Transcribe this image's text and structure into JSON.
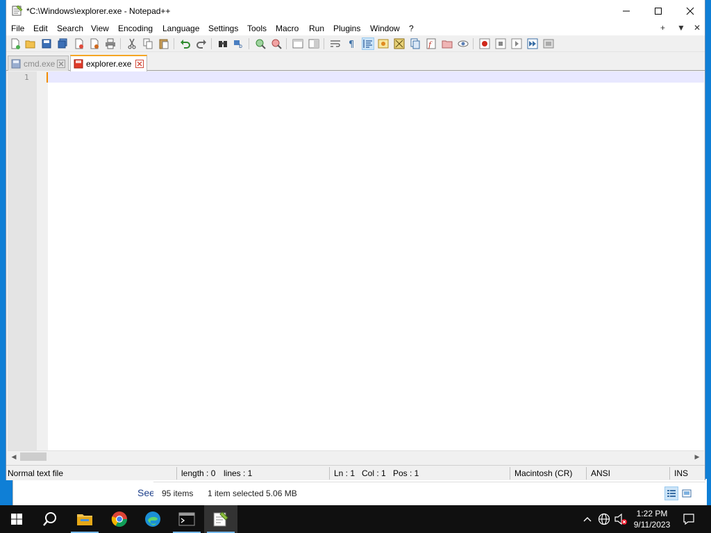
{
  "window": {
    "title": "*C:\\Windows\\explorer.exe - Notepad++"
  },
  "menu": {
    "items": [
      "File",
      "Edit",
      "Search",
      "View",
      "Encoding",
      "Language",
      "Settings",
      "Tools",
      "Macro",
      "Run",
      "Plugins",
      "Window",
      "?"
    ],
    "right": [
      "+",
      "▼",
      "✕"
    ]
  },
  "tabs": [
    {
      "label": "cmd.exe",
      "active": false
    },
    {
      "label": "explorer.exe",
      "active": true
    }
  ],
  "editor": {
    "line_numbers": [
      "1"
    ]
  },
  "status": {
    "file_type": "Normal text file",
    "length": "length : 0",
    "lines": "lines : 1",
    "ln": "Ln : 1",
    "col": "Col : 1",
    "pos": "Pos : 1",
    "eol": "Macintosh (CR)",
    "encoding": "ANSI",
    "mode": "INS"
  },
  "background_explorer": {
    "see_text": "See",
    "items_count": "95 items",
    "selection": "1 item selected  5.06 MB"
  },
  "taskbar": {
    "time": "1:22 PM",
    "date": "9/11/2023"
  },
  "colors": {
    "desktop": "#0f7fd6",
    "tab_accent": "#f5a623",
    "current_line": "#e8e8ff",
    "taskbar": "#101010"
  }
}
